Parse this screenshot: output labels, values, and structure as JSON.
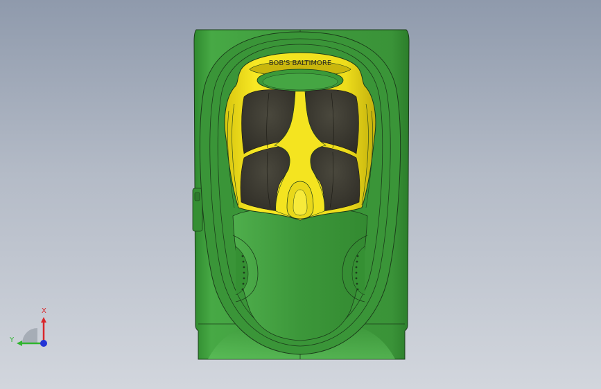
{
  "viewport": {
    "background_top": "#8f9aac",
    "background_bottom": "#d2d6dd"
  },
  "model": {
    "body_color": "#3f9a3d",
    "body_highlight": "#5dc35a",
    "body_edge": "#1b3d1a",
    "seat_color": "#f2e21e",
    "seat_shadow": "#c8b40e",
    "cushion_color": "#3e3c33",
    "emboss_text": "BOB'S  BALTIMORE"
  },
  "triad": {
    "x_label": "X",
    "y_label": "Y",
    "x_color": "#d9262a",
    "y_color": "#2fb52f",
    "z_color": "#2233d6"
  }
}
